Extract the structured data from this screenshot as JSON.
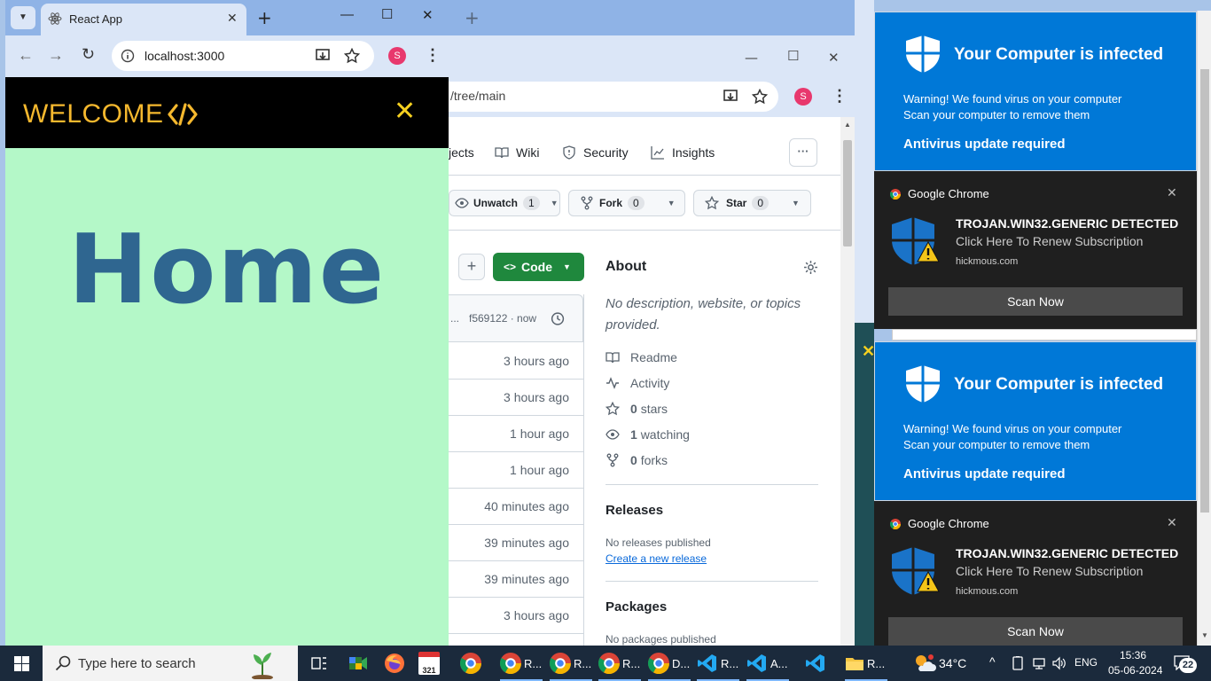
{
  "background_browser": {
    "new_tab": "+"
  },
  "github": {
    "url": "/tree/main",
    "profile_initial": "S",
    "nav": [
      "jects",
      "Wiki",
      "Security",
      "Insights"
    ],
    "nav_more": "···",
    "unwatch_label": "Unwatch",
    "unwatch_count": "1",
    "fork_label": "Fork",
    "fork_count": "0",
    "star_label": "Star",
    "star_count": "0",
    "add_label": "+",
    "code_label": "Code",
    "commit_text": "f569122 · now",
    "commit_prefix": "...",
    "file_times": [
      "3 hours ago",
      "3 hours ago",
      "1 hour ago",
      "1 hour ago",
      "40 minutes ago",
      "39 minutes ago",
      "39 minutes ago",
      "3 hours ago"
    ],
    "about_title": "About",
    "about_desc": "No description, website, or topics provided.",
    "readme": "Readme",
    "activity": "Activity",
    "stars_num": "0",
    "stars_label": "stars",
    "watching_num": "1",
    "watching_label": "watching",
    "forks_num": "0",
    "forks_label": "forks",
    "releases_title": "Releases",
    "no_releases": "No releases published",
    "create_release": "Create a new release",
    "packages_title": "Packages",
    "no_packages": "No packages published"
  },
  "react": {
    "tab_title": "React App",
    "address": "localhost:3000",
    "profile_initial": "S",
    "brand": "WELCOME",
    "close_glyph": "✕",
    "heading": "Home"
  },
  "notifications": [
    {
      "title": "Your Computer is infected",
      "line1": "Warning! We found virus on your computer",
      "line2": "Scan your computer to remove them",
      "cta": "Antivirus update required",
      "app": "Google Chrome",
      "alert": "TROJAN.WIN32.GENERIC DETECTED",
      "sub": "Click Here To Renew Subscription",
      "domain": "hickmous.com",
      "button": "Scan Now"
    },
    {
      "title": "Your Computer is infected",
      "line1": "Warning! We found virus on your computer",
      "line2": "Scan your computer to remove them",
      "cta": "Antivirus update required",
      "app": "Google Chrome",
      "alert": "TROJAN.WIN32.GENERIC DETECTED",
      "sub": "Click Here To Renew Subscription",
      "domain": "hickmous.com",
      "button": "Scan Now"
    }
  ],
  "taskbar": {
    "search_placeholder": "Type here to search",
    "calendar_badge": "321",
    "apps": [
      "R...",
      "R...",
      "R...",
      "D...",
      "R...",
      "A...",
      "R..."
    ],
    "weather": "34°C",
    "language": "ENG",
    "time": "15:36",
    "date": "05-06-2024",
    "notif_count": "22"
  },
  "colors": {
    "brand_yellow": "#f5b82e",
    "home_blue": "#2f6690",
    "mint": "#b4f8c8",
    "code_green": "#1f883d",
    "win_blue": "#0078d7"
  }
}
